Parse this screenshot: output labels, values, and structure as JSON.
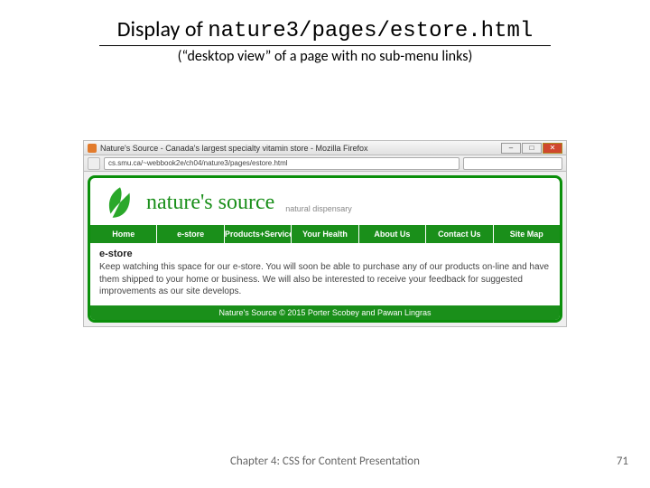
{
  "title": {
    "prefix": "Display of ",
    "path": "nature3/pages/estore.html"
  },
  "subtitle": "(“desktop view” of a page with no sub-menu links)",
  "browser": {
    "window_title": "Nature's Source - Canada's largest specialty vitamin store - Mozilla Firefox",
    "url": "cs.smu.ca/~webbook2e/ch04/nature3/pages/estore.html",
    "winbtns": {
      "min": "–",
      "max": "□",
      "close": "✕"
    }
  },
  "logo": {
    "brand": "nature's source",
    "tagline": "natural dispensary"
  },
  "nav": [
    "Home",
    "e-store",
    "Products+Services",
    "Your Health",
    "About Us",
    "Contact Us",
    "Site Map"
  ],
  "content": {
    "heading": "e-store",
    "body": "Keep watching this space for our e-store. You will soon be able to purchase any of our products on-line and have them shipped to your home or business. We will also be interested to receive your feedback for suggested improvements as our site develops."
  },
  "page_footer": "Nature's Source © 2015 Porter Scobey and Pawan Lingras",
  "slide_footer": "Chapter 4: CSS for Content Presentation",
  "page_number": "71"
}
